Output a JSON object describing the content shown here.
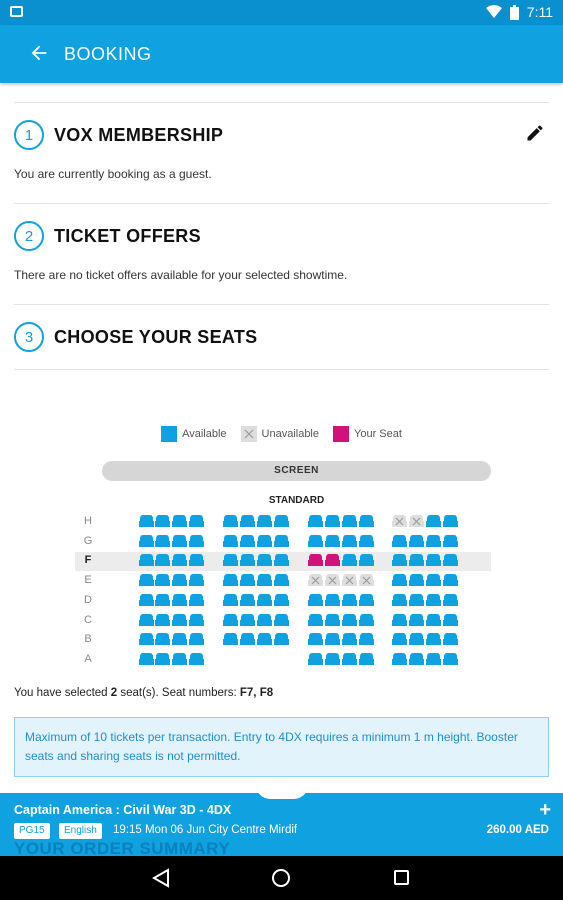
{
  "status_bar": {
    "time": "7:11"
  },
  "app_bar": {
    "title": "BOOKING"
  },
  "sections": [
    {
      "number": "1",
      "title": "VOX MEMBERSHIP",
      "text": "You are currently booking as a guest."
    },
    {
      "number": "2",
      "title": "TICKET OFFERS",
      "text": "There are no ticket offers available for your selected showtime."
    },
    {
      "number": "3",
      "title": "CHOOSE YOUR SEATS",
      "text": ""
    }
  ],
  "legend": {
    "available": "Available",
    "unavailable": "Unavailable",
    "your_seat": "Your Seat"
  },
  "seat_map": {
    "screen_label": "SCREEN",
    "section_label": "STANDARD",
    "rows": [
      "H",
      "G",
      "F",
      "E",
      "D",
      "C",
      "B",
      "A"
    ],
    "highlighted_row": "F"
  },
  "selection": {
    "prefix": "You have selected ",
    "count": "2",
    "mid": " seat(s). Seat numbers: ",
    "seats": "F7, F8"
  },
  "info": "Maximum of 10 tickets per transaction. Entry to 4DX requires a minimum 1 m height. Booster seats and sharing seats is not permitted.",
  "summary": {
    "movie": "Captain America : Civil War 3D - 4DX",
    "rating": "PG15",
    "language": "English",
    "showtime": "19:15 Mon 06 Jun  City Centre Mirdif",
    "price": "260.00 AED",
    "ghost_heading": "YOUR ORDER SUMMARY"
  },
  "colors": {
    "available": "#0fa1e0",
    "unavailable": "#dddddd",
    "your_seat": "#d1127a",
    "accent": "#0fa1e0"
  }
}
